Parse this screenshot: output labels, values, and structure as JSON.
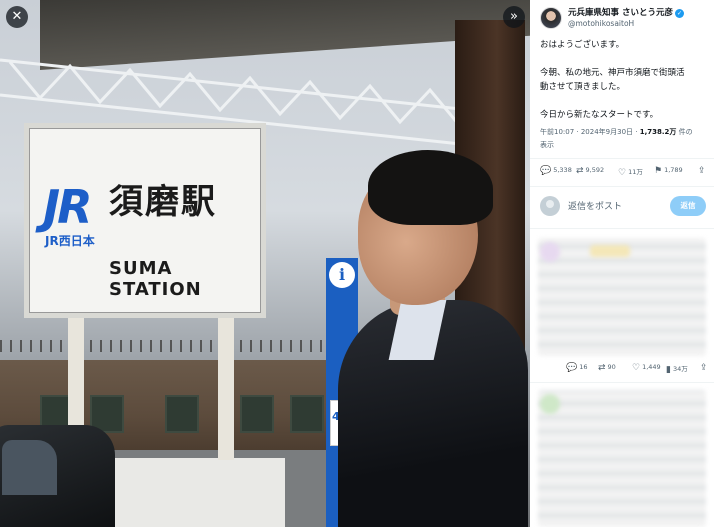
{
  "viewer": {
    "close_icon": "close-icon",
    "expand_icon": "double-chevron-right-icon",
    "photo": {
      "sign_logo": "JR",
      "sign_logo_sub": "JR西日本",
      "sign_name_ja": "須磨駅",
      "sign_name_en": "SUMA STATION",
      "info_symbol": "i",
      "track_number": "4"
    }
  },
  "tweet": {
    "author_name": "元兵庫県知事 さいとう元彦",
    "author_handle": "@motohikosaitoH",
    "verified_color": "#1d9bf0",
    "text": [
      "おはようございます。",
      "今朝、私の地元、神戸市須磨で街頭活\n動させて頂きました。",
      "今日から新たなスタートです。"
    ],
    "meta_time": "午前10:07 · 2024年9月30日 · ",
    "meta_views_count": "1,738.2万",
    "meta_views_suffix": " 件の",
    "meta_views_line2": "表示",
    "actions": {
      "replies": "5,338",
      "retweets": "9,592",
      "likes": "11万",
      "bookmarks": "1,789"
    }
  },
  "reply": {
    "placeholder": "返信をポスト",
    "button": "返信"
  },
  "second_post_actions": {
    "replies": "16",
    "retweets": "90",
    "likes": "1,449",
    "views": "34万"
  }
}
